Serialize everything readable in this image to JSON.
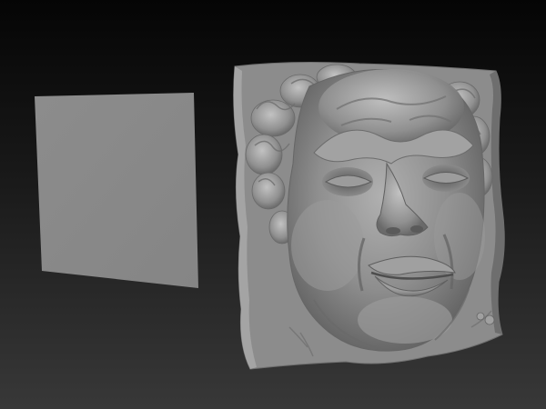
{
  "viewport": {
    "background_top": "#050505",
    "background_bottom": "#383838"
  },
  "objects": [
    {
      "name": "flat-plane-mesh",
      "surface_color": "#8a8a8a"
    },
    {
      "name": "sculpted-face-relief",
      "surface_color": "#8c8c8c"
    }
  ]
}
